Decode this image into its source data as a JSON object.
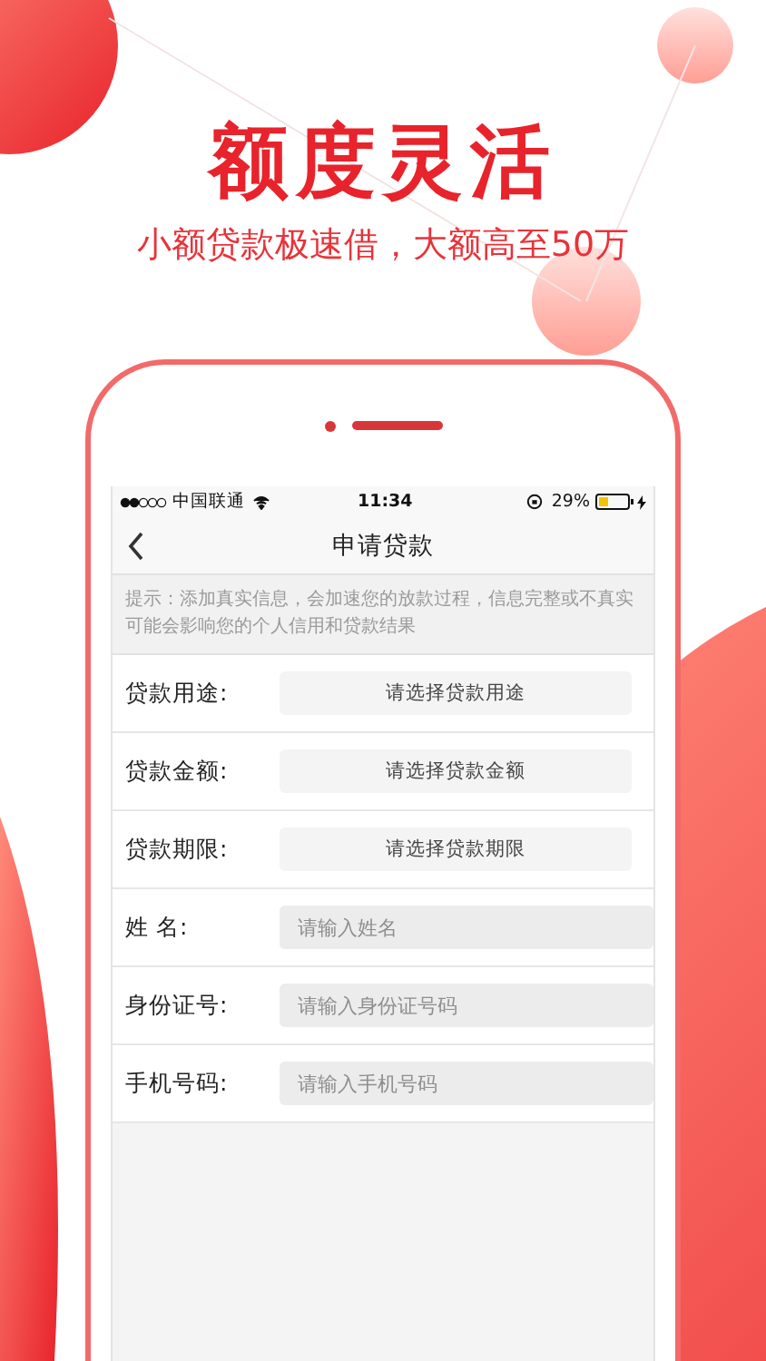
{
  "headline": "额度灵活",
  "subtitle": "小额贷款极速借，大额高至50万",
  "status_bar": {
    "carrier": "中国联通",
    "time": "11:34",
    "battery": "29%"
  },
  "nav": {
    "title": "申请贷款"
  },
  "hint": "提示：添加真实信息，会加速您的放款过程，信息完整或不真实可能会影响您的个人信用和贷款结果",
  "fields": [
    {
      "kind": "select",
      "label": "贷款用途:",
      "value": "请选择贷款用途"
    },
    {
      "kind": "select",
      "label": "贷款金额:",
      "value": "请选择贷款金额"
    },
    {
      "kind": "select",
      "label": "贷款期限:",
      "value": "请选择贷款期限"
    },
    {
      "kind": "input",
      "label": "姓 名:",
      "placeholder": "请输入姓名"
    },
    {
      "kind": "input",
      "label": "身份证号:",
      "placeholder": "请输入身份证号码"
    },
    {
      "kind": "input",
      "label": "手机号码:",
      "placeholder": "请输入手机号码"
    }
  ]
}
